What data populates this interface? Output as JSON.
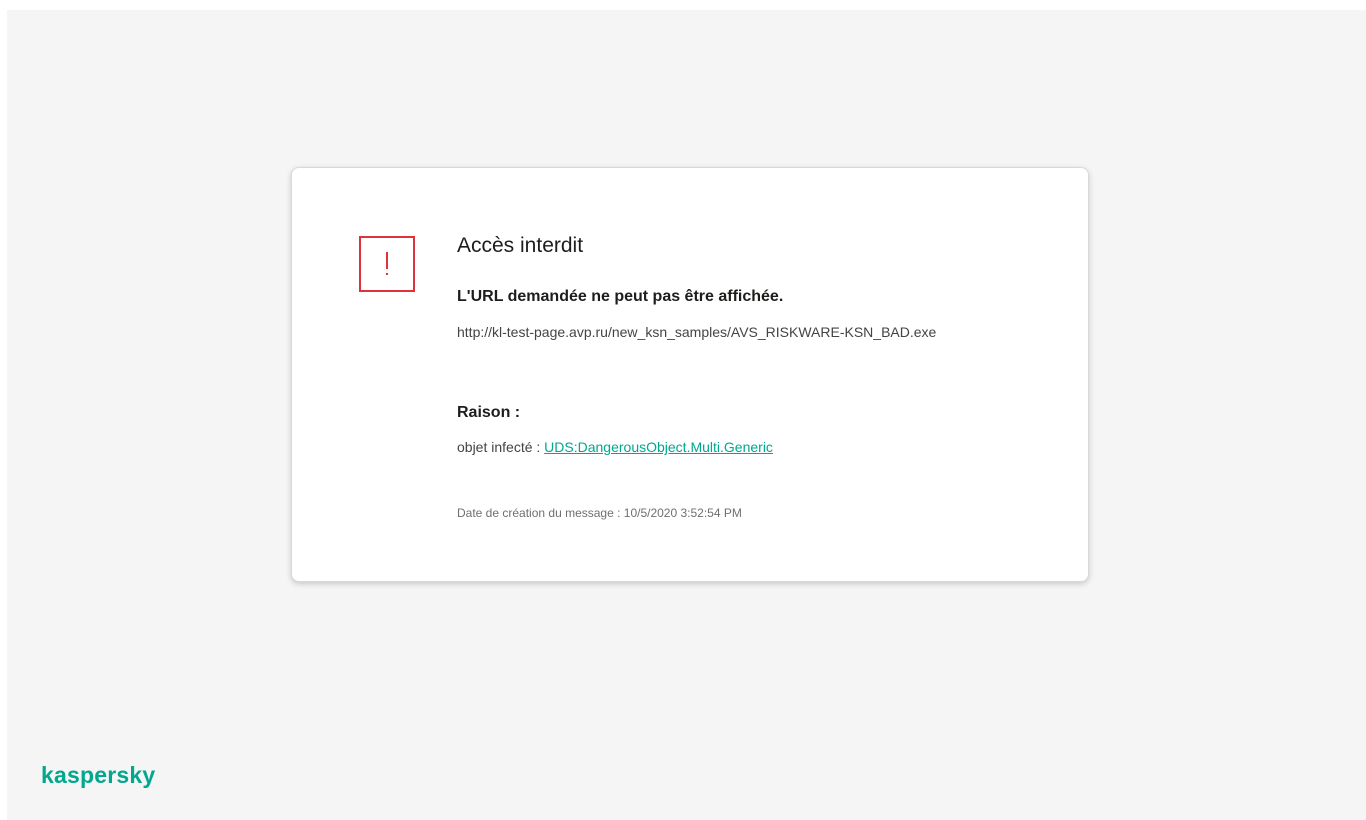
{
  "card": {
    "title": "Accès interdit",
    "subtitle": "L'URL demandée ne peut pas être affichée.",
    "url": "http://kl-test-page.avp.ru/new_ksn_samples/AVS_RISKWARE-KSN_BAD.exe",
    "reason_label": "Raison :",
    "reason_prefix": "objet infecté : ",
    "reason_link": "UDS:DangerousObject.Multi.Generic",
    "date_line": "Date de création du message : 10/5/2020 3:52:54 PM"
  },
  "brand": {
    "logo_text": "kaspersky"
  },
  "icons": {
    "warning": "exclamation-warning-icon"
  },
  "colors": {
    "accent": "#00a88e",
    "warning": "#e0323c",
    "background": "#f5f5f5",
    "card": "#ffffff"
  }
}
